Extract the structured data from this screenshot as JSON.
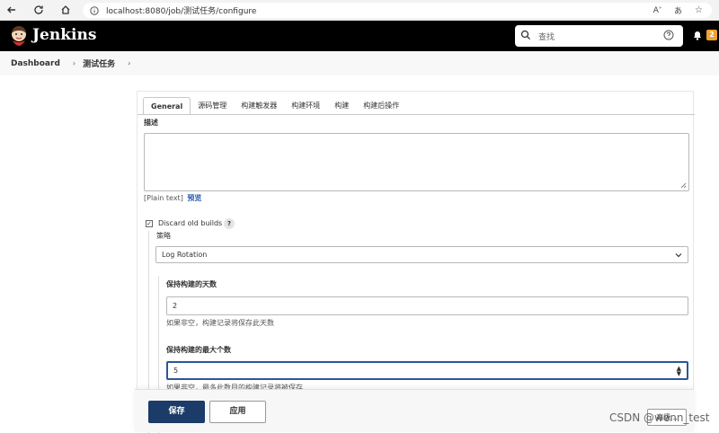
{
  "browser": {
    "url": "localhost:8080/job/测试任务/configure",
    "right_icons": [
      "read-aloud-icon",
      "translate-icon",
      "favorite-icon"
    ]
  },
  "header": {
    "title": "Jenkins",
    "search_placeholder": "查找",
    "notification_count": "2",
    "badge_color": "#f0a030"
  },
  "breadcrumb": {
    "items": [
      "Dashboard",
      "测试任务"
    ]
  },
  "tabs": [
    "General",
    "源码管理",
    "构建触发器",
    "构建环境",
    "构建",
    "构建后操作"
  ],
  "form": {
    "description_label": "描述",
    "description_value": "",
    "plain_text": "[Plain text]",
    "preview_link": "预览",
    "discard_label": "Discard old builds",
    "discard_checked": true,
    "help": "?",
    "strategy_label": "策略",
    "strategy_value": "Log Rotation",
    "days_label": "保持构建的天数",
    "days_value": "2",
    "days_hint": "如果非空，构建记录将保存此天数",
    "max_label": "保持构建的最大个数",
    "max_value": "5",
    "max_hint": "如果非空，最多此数目的构建记录将被保存"
  },
  "actions": {
    "save": "保存",
    "apply": "应用",
    "advanced": "高级..."
  },
  "watermark": "CSDN @wenn_test",
  "colors": {
    "primary": "#1b3b68",
    "header_bg": "#000000",
    "focus": "#2b5797",
    "link": "#2a5db0"
  }
}
